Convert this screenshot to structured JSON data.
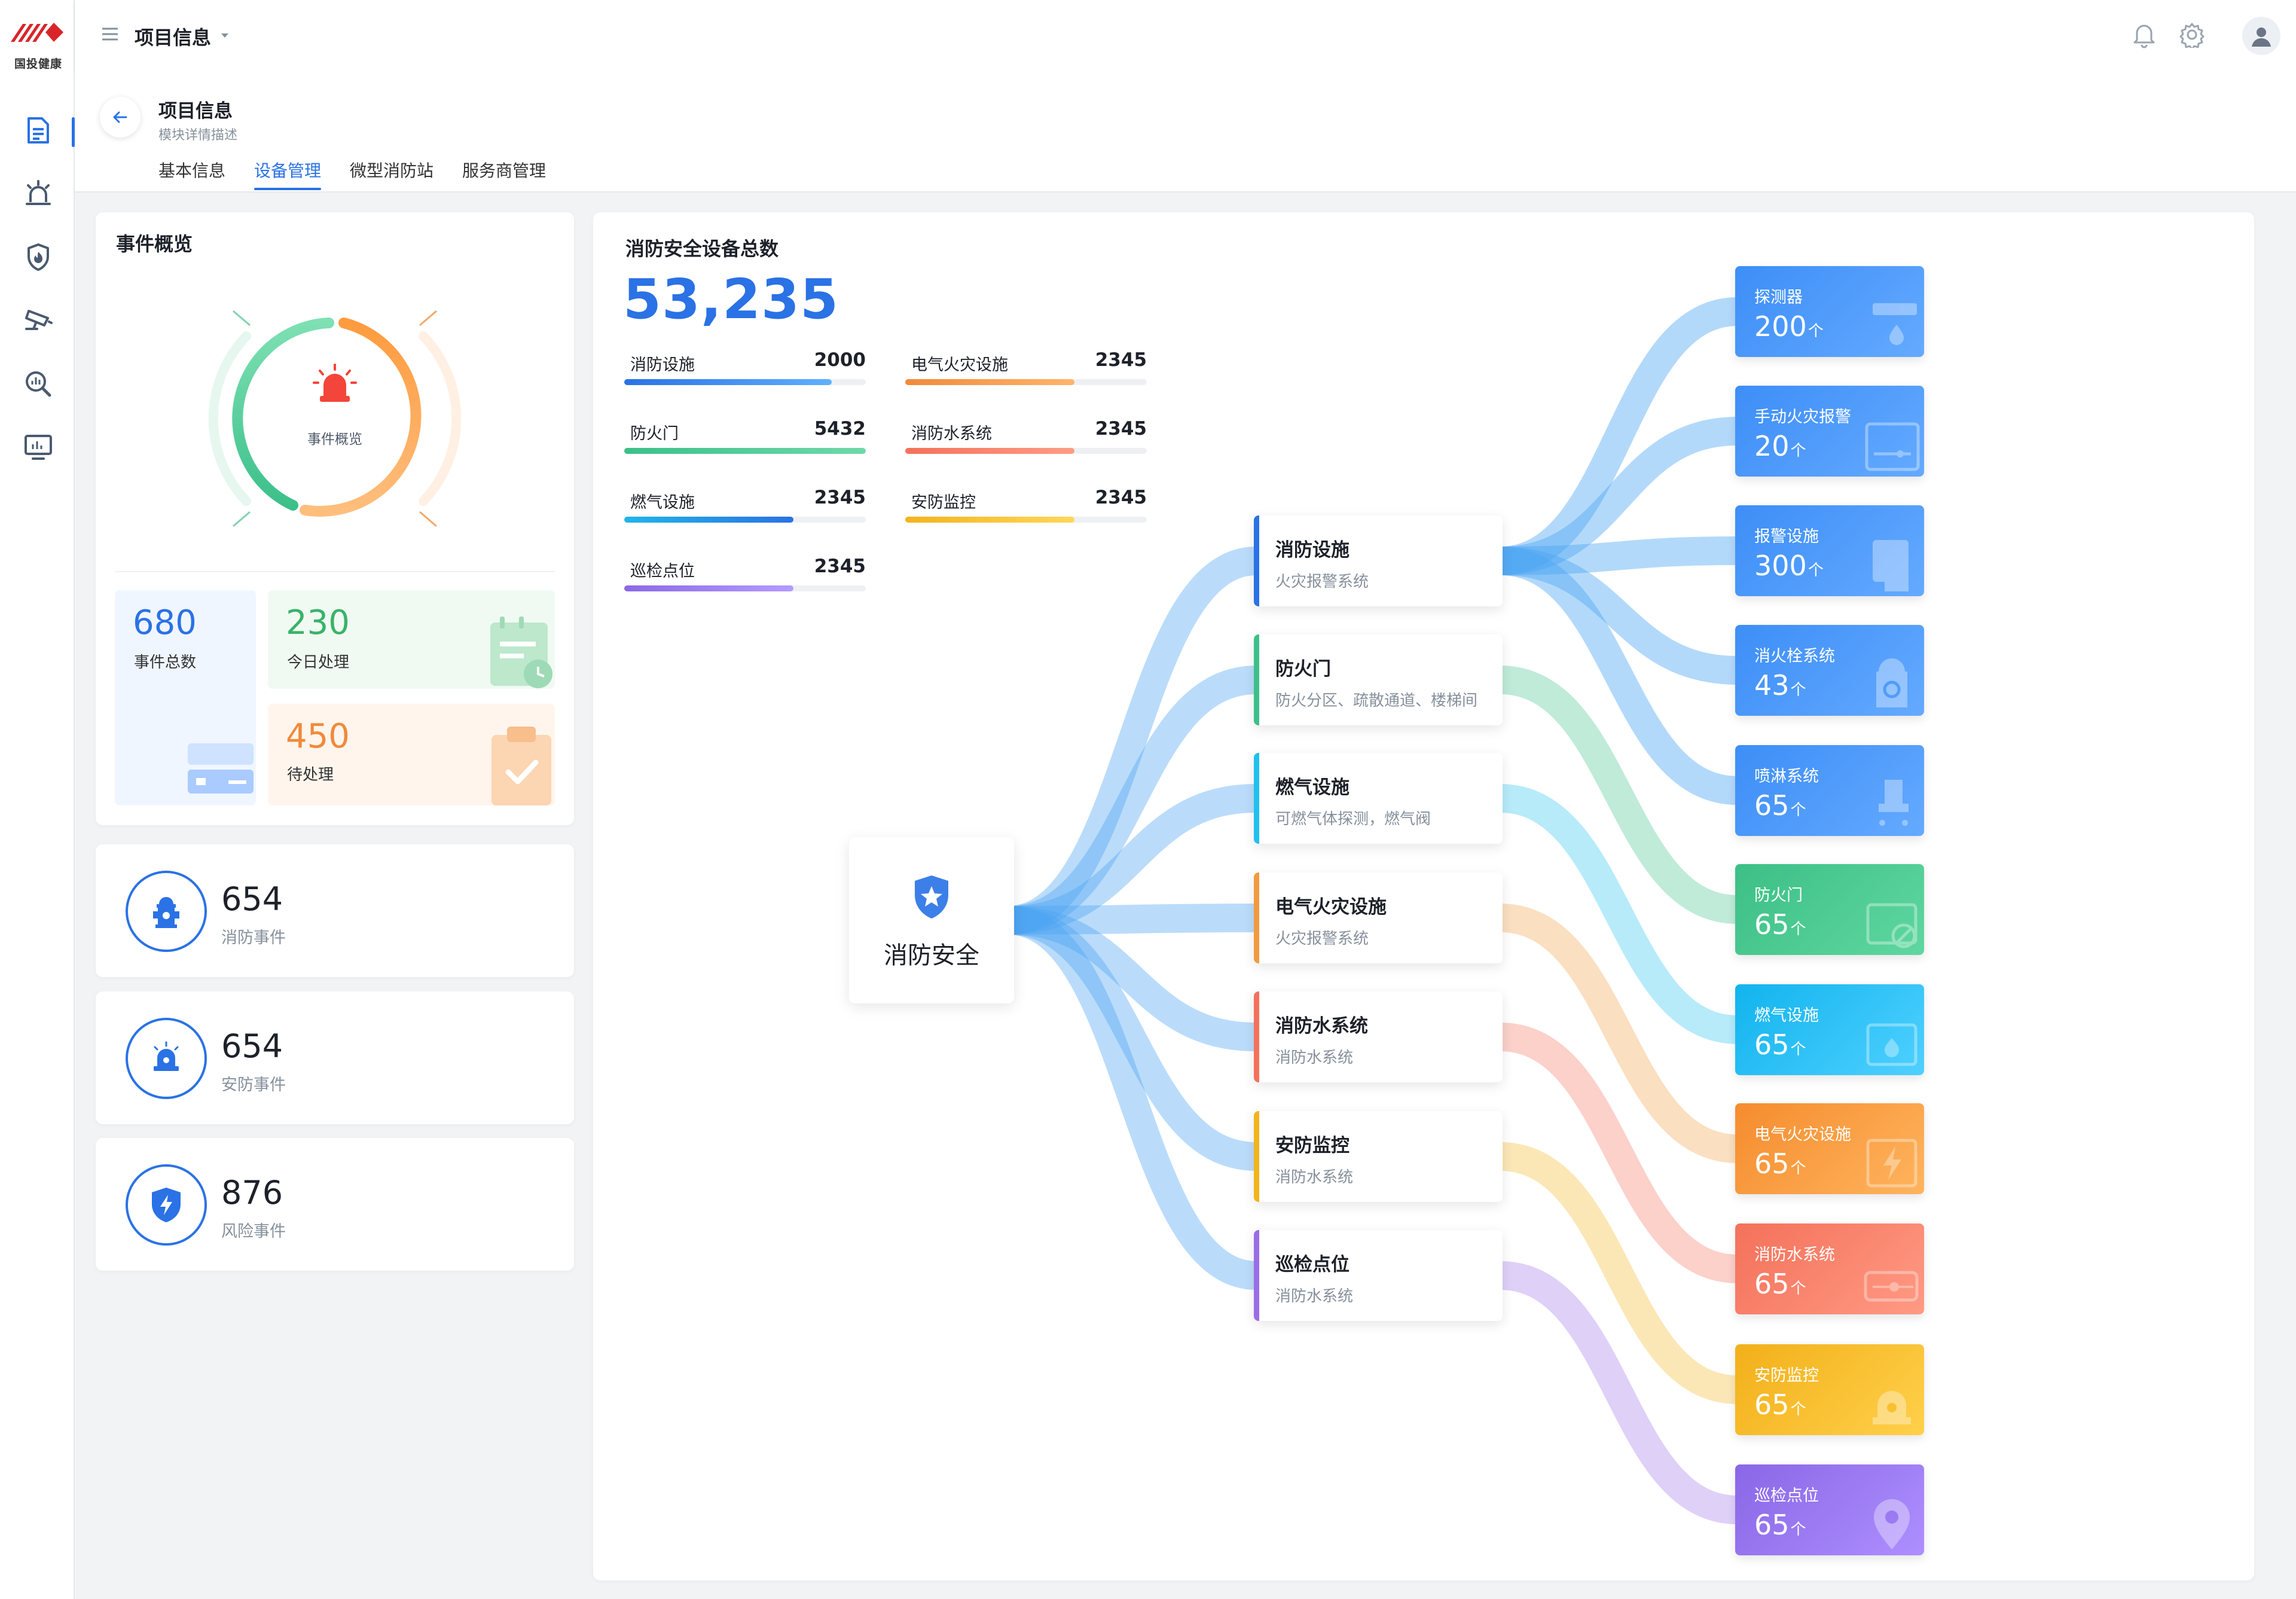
{
  "app": {
    "logo_text": "国投健康",
    "header_title": "项目信息",
    "colors": {
      "primary": "#2a72e5",
      "background": "#f2f3f5",
      "brand_red": "#d9252a"
    }
  },
  "sidebar": {
    "items": [
      {
        "icon": "document-icon",
        "active": true
      },
      {
        "icon": "alarm-icon",
        "active": false
      },
      {
        "icon": "shield-fire-icon",
        "active": false
      },
      {
        "icon": "camera-icon",
        "active": false
      },
      {
        "icon": "search-chart-icon",
        "active": false
      },
      {
        "icon": "monitor-chart-icon",
        "active": false
      }
    ]
  },
  "page": {
    "title": "项目信息",
    "description": "模块详情描述",
    "tabs": [
      {
        "label": "基本信息",
        "active": false
      },
      {
        "label": "设备管理",
        "active": true
      },
      {
        "label": "微型消防站",
        "active": false
      },
      {
        "label": "服务商管理",
        "active": false
      }
    ]
  },
  "overview": {
    "title": "事件概览",
    "gauge_label": "事件概览",
    "total": {
      "value": "680",
      "label": "事件总数"
    },
    "today": {
      "value": "230",
      "label": "今日处理"
    },
    "pending": {
      "value": "450",
      "label": "待处理"
    }
  },
  "event_stats": [
    {
      "value": "654",
      "label": "消防事件",
      "icon": "hydrant-icon"
    },
    {
      "value": "654",
      "label": "安防事件",
      "icon": "siren-icon"
    },
    {
      "value": "876",
      "label": "风险事件",
      "icon": "shield-bolt-icon"
    }
  ],
  "devices": {
    "title": "消防安全设备总数",
    "total": "53,235",
    "metrics": [
      {
        "name": "消防设施",
        "value": "2000",
        "fill": 0.86,
        "color": "#2a72e5",
        "color2": "#5fb0ff"
      },
      {
        "name": "电气火灾设施",
        "value": "2345",
        "fill": 0.7,
        "color": "#f08a3b",
        "color2": "#ffb56a"
      },
      {
        "name": "防火门",
        "value": "5432",
        "fill": 1.0,
        "color": "#3cc08a",
        "color2": "#6fd9a8"
      },
      {
        "name": "消防水系统",
        "value": "2345",
        "fill": 0.7,
        "color": "#f4715a",
        "color2": "#ff9c86"
      },
      {
        "name": "燃气设施",
        "value": "2345",
        "fill": 0.7,
        "color": "#1fb6e8",
        "color2": "#2a72e5"
      },
      {
        "name": "安防监控",
        "value": "2345",
        "fill": 0.7,
        "color": "#f2b41c",
        "color2": "#ffd75a"
      },
      {
        "name": "巡检点位",
        "value": "2345",
        "fill": 0.7,
        "color": "#8b68e6",
        "color2": "#b49bff"
      }
    ],
    "root": {
      "label": "消防安全"
    },
    "categories": [
      {
        "name": "消防设施",
        "sub": "火灾报警系统",
        "color": "#2a72e5"
      },
      {
        "name": "防火门",
        "sub": "防火分区、疏散通道、楼梯间",
        "color": "#3cc08a"
      },
      {
        "name": "燃气设施",
        "sub": "可燃气体探测，燃气阀",
        "color": "#1fc0ef"
      },
      {
        "name": "电气火灾设施",
        "sub": "火灾报警系统",
        "color": "#f29a3f"
      },
      {
        "name": "消防水系统",
        "sub": "消防水系统",
        "color": "#f4715a"
      },
      {
        "name": "安防监控",
        "sub": "消防水系统",
        "color": "#f2b41c"
      },
      {
        "name": "巡检点位",
        "sub": "消防水系统",
        "color": "#9a6de8"
      }
    ],
    "leaves": [
      {
        "name": "探测器",
        "value": "200",
        "unit": "个",
        "from": 0,
        "colors": [
          "#3d8ef7",
          "#64aaff"
        ]
      },
      {
        "name": "手动火灾报警",
        "value": "20",
        "unit": "个",
        "from": 0,
        "colors": [
          "#3d8ef7",
          "#64aaff"
        ]
      },
      {
        "name": "报警设施",
        "value": "300",
        "unit": "个",
        "from": 0,
        "colors": [
          "#3d8ef7",
          "#64aaff"
        ]
      },
      {
        "name": "消火栓系统",
        "value": "43",
        "unit": "个",
        "from": 0,
        "colors": [
          "#3d8ef7",
          "#64aaff"
        ]
      },
      {
        "name": "喷淋系统",
        "value": "65",
        "unit": "个",
        "from": 0,
        "colors": [
          "#3d8ef7",
          "#64aaff"
        ]
      },
      {
        "name": "防火门",
        "value": "65",
        "unit": "个",
        "from": 1,
        "colors": [
          "#3cbf86",
          "#5fd7a0"
        ]
      },
      {
        "name": "燃气设施",
        "value": "65",
        "unit": "个",
        "from": 2,
        "colors": [
          "#12b4ee",
          "#4fd0ff"
        ]
      },
      {
        "name": "电气火灾设施",
        "value": "65",
        "unit": "个",
        "from": 3,
        "colors": [
          "#f58c2e",
          "#ffb45e"
        ]
      },
      {
        "name": "消防水系统",
        "value": "65",
        "unit": "个",
        "from": 4,
        "colors": [
          "#f4715a",
          "#ff9a84"
        ]
      },
      {
        "name": "安防监控",
        "value": "65",
        "unit": "个",
        "from": 5,
        "colors": [
          "#f2b01a",
          "#ffd04a"
        ]
      },
      {
        "name": "巡检点位",
        "value": "65",
        "unit": "个",
        "from": 6,
        "colors": [
          "#8a67e6",
          "#ae8fff"
        ]
      }
    ]
  }
}
